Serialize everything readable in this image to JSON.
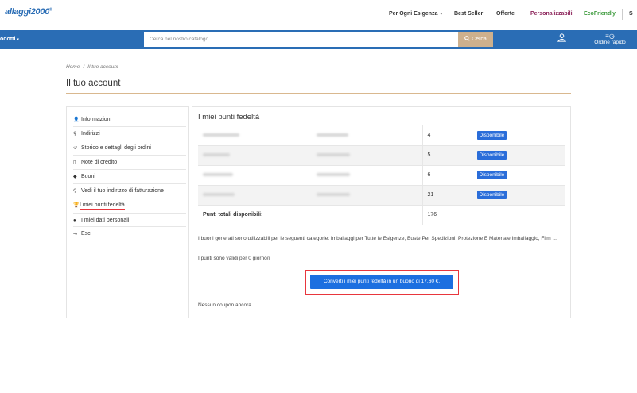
{
  "header": {
    "logo": "allaggi2000",
    "logo_mark": "®",
    "nav": [
      {
        "label": "Per Ogni Esigenza",
        "color": "#333333"
      },
      {
        "label": "Best Seller",
        "color": "#333333"
      },
      {
        "label": "Offerte",
        "color": "#333333"
      },
      {
        "label": "Personalizzabili",
        "color": "#8a2158"
      },
      {
        "label": "EcoFriendly",
        "color": "#3c9a3c"
      },
      {
        "label": "S",
        "color": "#333333"
      }
    ],
    "nav_caret": "▾"
  },
  "bluebar": {
    "color": "#2a6db5",
    "products_label": "odotti",
    "products_caret": "▾",
    "search_placeholder": "Cerca nel nostro catalogo",
    "search_button": "Cerca",
    "search_button_color": "#cdb08d",
    "user_icon": "user-icon",
    "quick_order_label": "Ordine rapido",
    "quick_order_icon": "≡◷"
  },
  "breadcrumb": {
    "home": "Home",
    "separator": "/",
    "current": "Il tuo account"
  },
  "page_title": "Il tuo account",
  "sidebar": {
    "items": [
      {
        "icon": "user-icon",
        "glyph": "👤",
        "label": "Informazioni"
      },
      {
        "icon": "map-marker-icon",
        "glyph": "⚲",
        "label": "Indirizzi"
      },
      {
        "icon": "history-icon",
        "glyph": "↺",
        "label": "Storico e dettagli degli ordini"
      },
      {
        "icon": "file-icon",
        "glyph": "▯",
        "label": "Note di credito"
      },
      {
        "icon": "tag-icon",
        "glyph": "◆",
        "label": "Buoni"
      },
      {
        "icon": "map-marker-icon",
        "glyph": "⚲",
        "label": "Vedi il tuo indirizzo di fatturazione"
      },
      {
        "icon": "trophy-icon",
        "glyph": "🏆",
        "label": "I miei punti fedeltà",
        "active": true
      },
      {
        "icon": "user-secret-icon",
        "glyph": "●",
        "label": "I miei dati personali"
      },
      {
        "icon": "sign-out-icon",
        "glyph": "⇥",
        "label": "Esci"
      }
    ],
    "active_underline_color": "#e8363d"
  },
  "main": {
    "title": "I miei punti fedeltà",
    "rows": [
      {
        "points": "4",
        "status": "Disponibile"
      },
      {
        "points": "5",
        "status": "Disponibile"
      },
      {
        "points": "6",
        "status": "Disponibile"
      },
      {
        "points": "21",
        "status": "Disponibile"
      }
    ],
    "total_label": "Punti totali disponibili:",
    "total_value": "176",
    "badge_color": "#2a6dd9",
    "info_categories": "I buoni generati sono utilizzabili per le seguenti categorie: Imballaggi per Tutte le Esigenze, Buste Per Spedizioni, Protezione E Materiale Imballaggio, Film ...",
    "info_validity": "I punti sono validi per 0 giorno/i",
    "convert_button": "Converti i miei punti fedeltà in un buono di 17,60 €.",
    "convert_button_color": "#1c6fe0",
    "highlight_color": "#e8363d",
    "no_coupon": "Nessun coupon ancora."
  }
}
